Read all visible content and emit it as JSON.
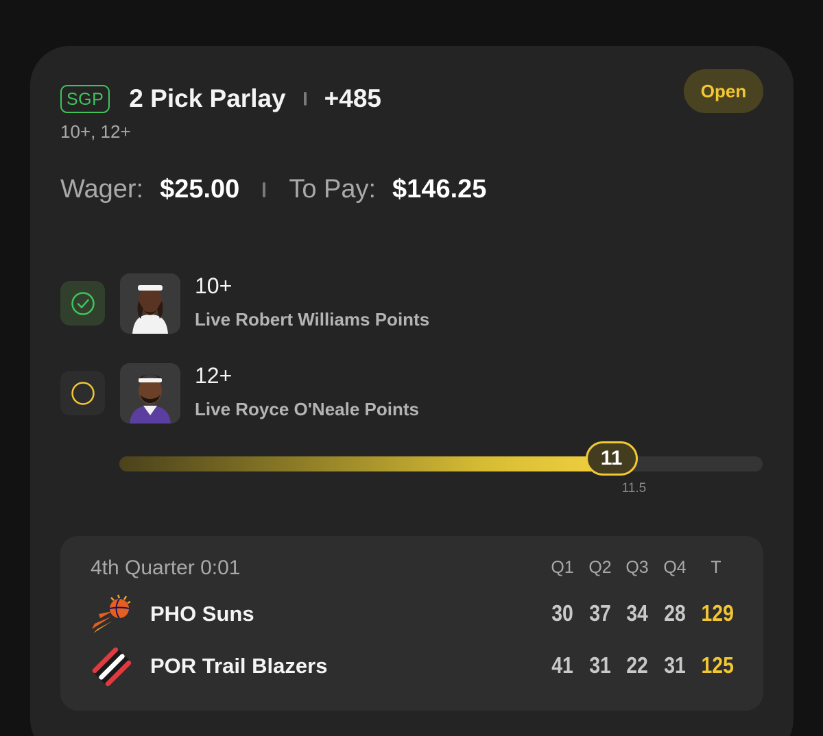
{
  "bet": {
    "badge": "SGP",
    "title": "2 Pick Parlay",
    "odds": "+485",
    "subtitle": "10+, 12+",
    "status": "Open",
    "wager_label": "Wager:",
    "wager_value": "$25.00",
    "topay_label": "To Pay:",
    "topay_value": "$146.25"
  },
  "legs": [
    {
      "line": "10+",
      "description": "Live Robert Williams Points",
      "state": "won"
    },
    {
      "line": "12+",
      "description": "Live Royce O'Neale Points",
      "state": "pending"
    }
  ],
  "progress": {
    "current": "11",
    "target_label": "11.5",
    "fraction": 0.765,
    "target_fraction": 0.8
  },
  "game": {
    "status": "4th Quarter 0:01",
    "columns": [
      "Q1",
      "Q2",
      "Q3",
      "Q4",
      "T"
    ],
    "teams": [
      {
        "name": "PHO Suns",
        "scores": [
          "30",
          "37",
          "34",
          "28"
        ],
        "total": "129",
        "logo": "suns-logo"
      },
      {
        "name": "POR Trail Blazers",
        "scores": [
          "41",
          "31",
          "22",
          "31"
        ],
        "total": "125",
        "logo": "trail-blazers-logo"
      }
    ]
  },
  "colors": {
    "accent_yellow": "#f2c732",
    "win_green": "#3fc45a",
    "card_bg": "#242424"
  }
}
